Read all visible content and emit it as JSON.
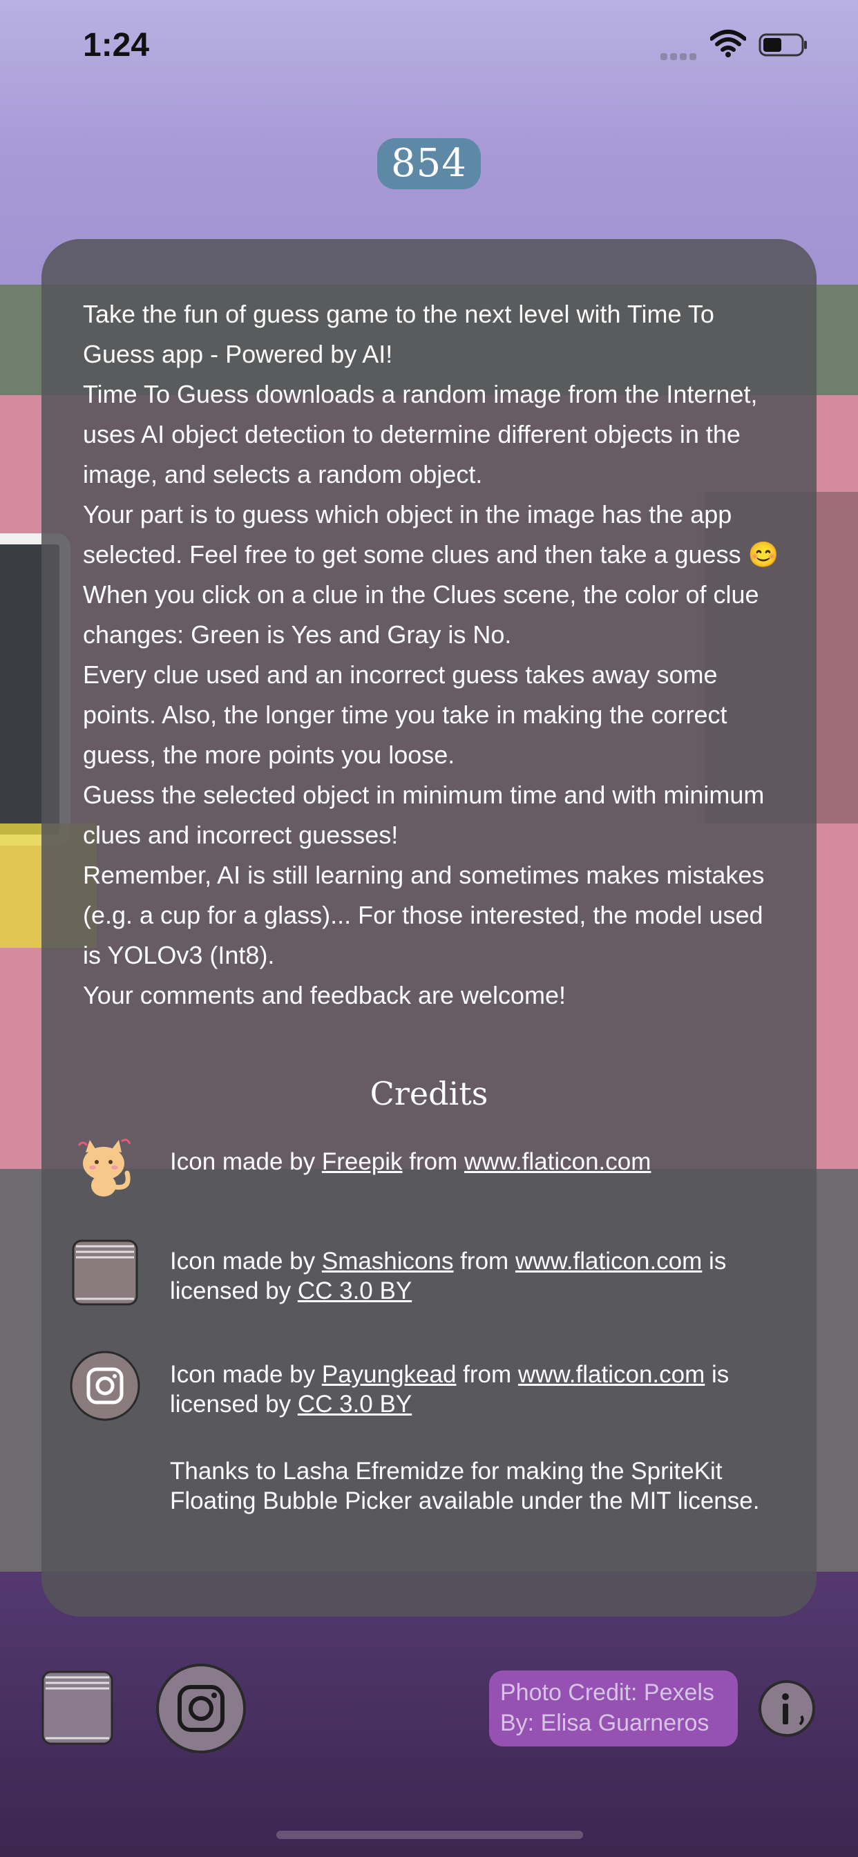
{
  "status_bar": {
    "time": "1:24",
    "icons": [
      "signal-icon",
      "wifi-icon",
      "battery-icon"
    ]
  },
  "score": "854",
  "info": {
    "paragraphs": [
      "Take the fun of guess game to the next level with Time To Guess app - Powered by AI!",
      "Time To Guess downloads a random image from the Internet, uses AI object detection to determine different objects in the image, and selects a random object.",
      "Your part is to guess which object in the image has the app selected. Feel free to get some clues and then take a guess 😊",
      "When you click on a clue in the Clues scene, the color of clue changes: Green is Yes and Gray is No.",
      "Every clue used and an incorrect guess takes away some points. Also, the longer time you take in making the correct guess, the more points you loose.",
      "Guess the selected object in minimum time and with minimum clues and incorrect guesses!",
      "Remember, AI is still learning and sometimes makes mistakes (e.g. a cup for a glass)... For those interested, the model used is YOLOv3 (Int8).",
      "Your comments and feedback are welcome!"
    ]
  },
  "credits": {
    "title": "Credits",
    "items": [
      {
        "icon": "cat-icon",
        "prefix": "Icon made by ",
        "author": "Freepik",
        "middle": " from ",
        "site": "www.flaticon.com",
        "suffix": "",
        "license_prefix": "",
        "license": ""
      },
      {
        "icon": "stack-icon",
        "prefix": "Icon made by ",
        "author": "Smashicons",
        "middle": " from ",
        "site": "www.flaticon.com",
        "suffix": " is",
        "license_prefix": "licensed by ",
        "license": "CC 3.0 BY"
      },
      {
        "icon": "instagram-icon",
        "prefix": "Icon made by ",
        "author": "Payungkead",
        "middle": " from ",
        "site": "www.flaticon.com",
        "suffix": " is",
        "license_prefix": "licensed by ",
        "license": "CC 3.0 BY"
      }
    ],
    "thanks": "Thanks to Lasha Efremidze for making the SpriteKit Floating Bubble Picker available under the MIT license."
  },
  "bottom_bar": {
    "photo_credit_line1": "Photo Credit: Pexels",
    "photo_credit_line2": "By: Elisa Guarneros"
  },
  "colors": {
    "score_badge": "#5d88a6",
    "panel": "#55555a",
    "photo_credit_bg": "#9552b3"
  }
}
